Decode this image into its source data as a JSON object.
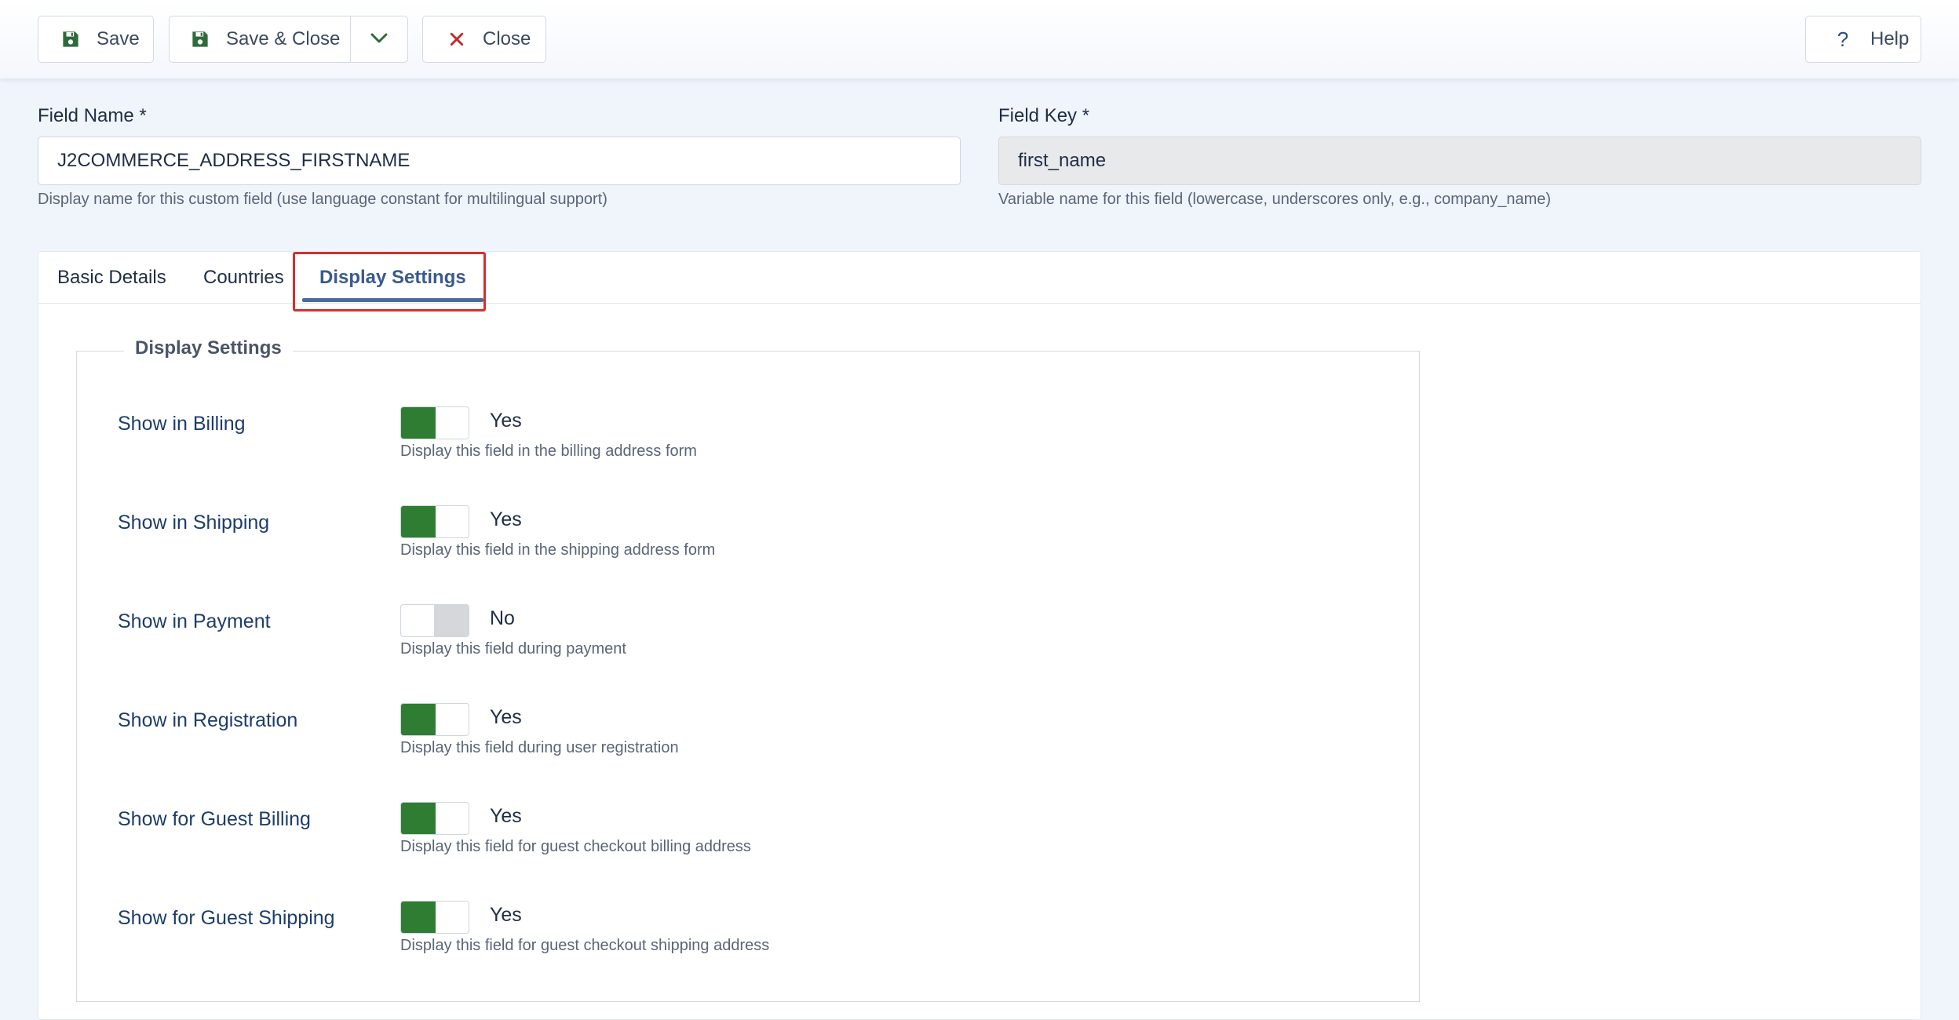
{
  "toolbar": {
    "save_label": "Save",
    "save_close_label": "Save & Close",
    "close_label": "Close",
    "help_label": "Help"
  },
  "field_name": {
    "label": "Field Name *",
    "value": "J2COMMERCE_ADDRESS_FIRSTNAME",
    "help": "Display name for this custom field (use language constant for multilingual support)"
  },
  "field_key": {
    "label": "Field Key *",
    "value": "first_name",
    "help": "Variable name for this field (lowercase, underscores only, e.g., company_name)"
  },
  "tabs": [
    {
      "label": "Basic Details",
      "active": false
    },
    {
      "label": "Countries",
      "active": false
    },
    {
      "label": "Display Settings",
      "active": true
    }
  ],
  "display_settings": {
    "legend": "Display Settings",
    "rows": [
      {
        "label": "Show in Billing",
        "state": "Yes",
        "on": true,
        "help": "Display this field in the billing address form"
      },
      {
        "label": "Show in Shipping",
        "state": "Yes",
        "on": true,
        "help": "Display this field in the shipping address form"
      },
      {
        "label": "Show in Payment",
        "state": "No",
        "on": false,
        "help": "Display this field during payment"
      },
      {
        "label": "Show in Registration",
        "state": "Yes",
        "on": true,
        "help": "Display this field during user registration"
      },
      {
        "label": "Show for Guest Billing",
        "state": "Yes",
        "on": true,
        "help": "Display this field for guest checkout billing address"
      },
      {
        "label": "Show for Guest Shipping",
        "state": "Yes",
        "on": true,
        "help": "Display this field for guest checkout shipping address"
      }
    ]
  },
  "colors": {
    "toggle_on": "#2e7d32",
    "toggle_off": "#d5d7da",
    "highlight": "#d32f2f",
    "active_tab": "#3a5a8e"
  }
}
